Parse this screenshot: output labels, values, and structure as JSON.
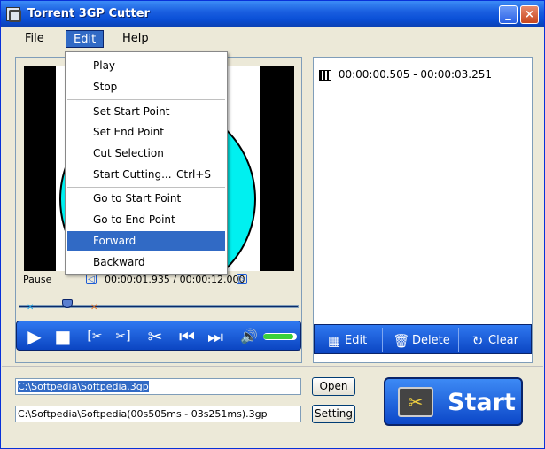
{
  "window": {
    "title": "Torrent 3GP Cutter",
    "min_label": "_",
    "close_label": "×"
  },
  "menubar": {
    "file": "File",
    "edit": "Edit",
    "help": "Help"
  },
  "edit_menu": {
    "items": [
      {
        "label": "Play",
        "shortcut": ""
      },
      {
        "label": "Stop",
        "shortcut": ""
      },
      {
        "label": "Set Start Point",
        "shortcut": ""
      },
      {
        "label": "Set End Point",
        "shortcut": ""
      },
      {
        "label": "Cut Selection",
        "shortcut": ""
      },
      {
        "label": "Start Cutting...",
        "shortcut": "Ctrl+S"
      },
      {
        "label": "Go to Start Point",
        "shortcut": ""
      },
      {
        "label": "Go to End Point",
        "shortcut": ""
      },
      {
        "label": "Forward",
        "shortcut": ""
      },
      {
        "label": "Backward",
        "shortcut": ""
      }
    ],
    "selected": "Forward"
  },
  "player": {
    "state": "Pause",
    "time": "00:00:01.935 / 00:00:12.000",
    "position_fraction": 0.16,
    "volume_fraction": 0.9
  },
  "segments": {
    "items": [
      "00:00:00.505 - 00:00:03.251"
    ],
    "edit_label": "Edit",
    "delete_label": "Delete",
    "clear_label": "Clear"
  },
  "files": {
    "input_path": "C:\\Softpedia\\Softpedia.3gp",
    "output_path": "C:\\Softpedia\\Softpedia(00s505ms - 03s251ms).3gp",
    "open_label": "Open",
    "setting_label": "Setting",
    "start_label": "Start"
  },
  "colors": {
    "accent": "#316ac5",
    "toolbar": "#1a5fe0",
    "dial": "#00f0f0"
  }
}
